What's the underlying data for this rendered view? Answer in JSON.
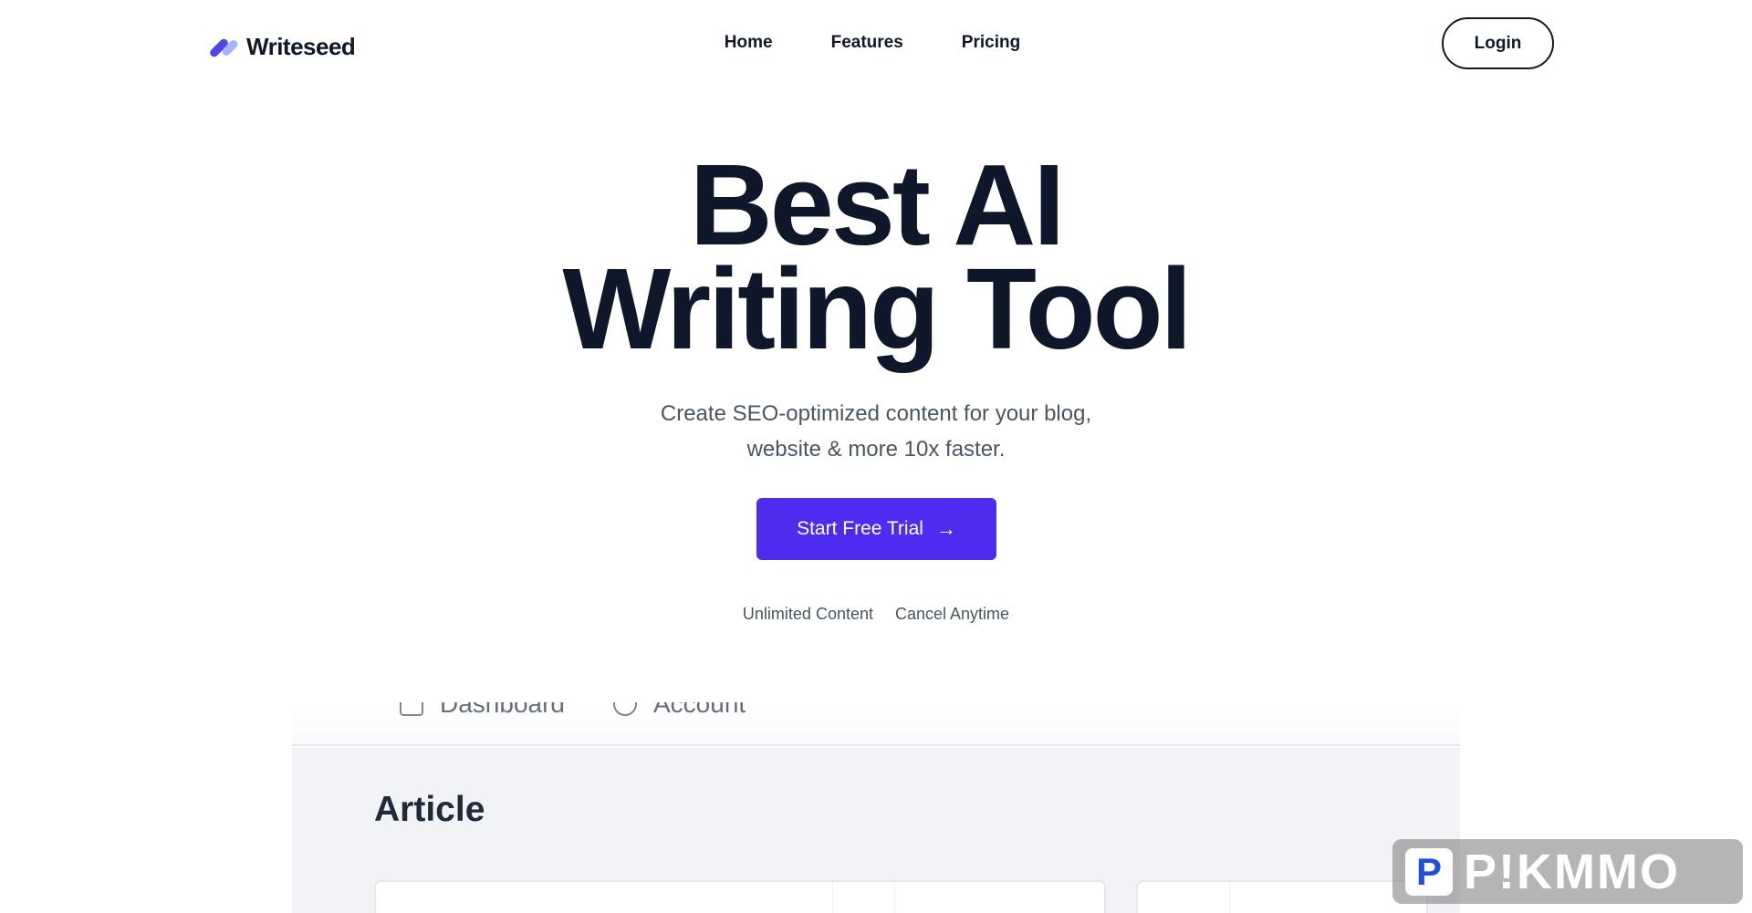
{
  "header": {
    "logo_text": "Writeseed",
    "nav": [
      "Home",
      "Features",
      "Pricing"
    ],
    "login_label": "Login"
  },
  "hero": {
    "title_line1": "Best AI",
    "title_line2": "Writing Tool",
    "subtitle_line1": "Create SEO-optimized content for your blog,",
    "subtitle_line2": "website & more 10x faster.",
    "cta_label": "Start Free Trial",
    "cta_icon": "arrow-right-icon",
    "perks": [
      "Unlimited Content",
      "Cancel Anytime"
    ]
  },
  "preview": {
    "tabs": [
      {
        "label": "Dashboard",
        "icon": "grid-icon"
      },
      {
        "label": "Account",
        "icon": "user-icon"
      }
    ],
    "page_title": "Article"
  },
  "watermark": {
    "badge": "P",
    "text": "P!KMMO"
  },
  "colors": {
    "accent": "#4f2bf0",
    "text_dark": "#0f172a",
    "text_muted": "#4b5563",
    "preview_bg": "#f1f3f7"
  }
}
